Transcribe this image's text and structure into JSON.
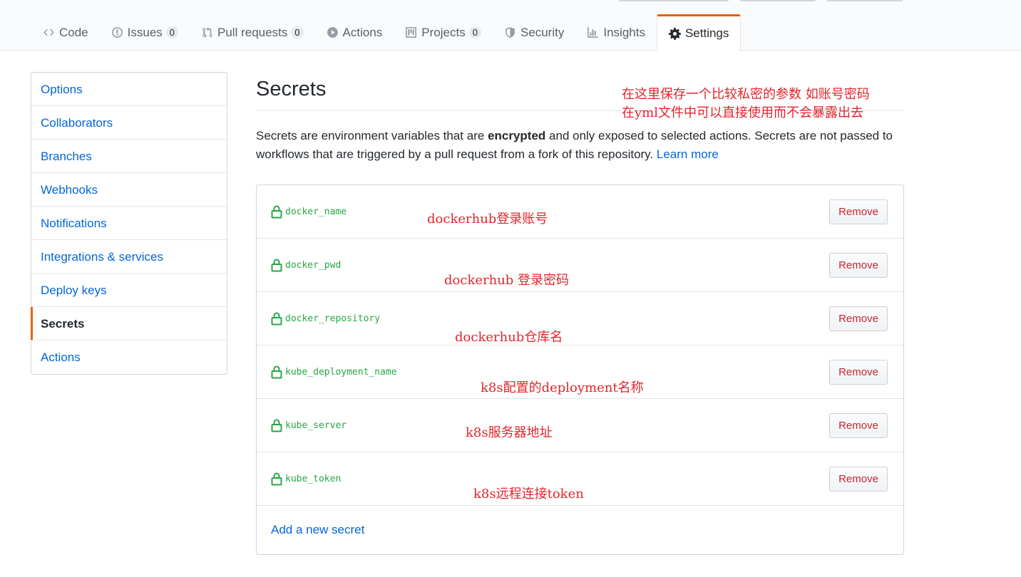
{
  "tabs": [
    {
      "label": "Code",
      "icon": "code-icon",
      "counter": null,
      "selected": false
    },
    {
      "label": "Issues",
      "icon": "issue-icon",
      "counter": "0",
      "selected": false
    },
    {
      "label": "Pull requests",
      "icon": "pull-request-icon",
      "counter": "0",
      "selected": false
    },
    {
      "label": "Actions",
      "icon": "play-icon",
      "counter": null,
      "selected": false
    },
    {
      "label": "Projects",
      "icon": "project-icon",
      "counter": "0",
      "selected": false
    },
    {
      "label": "Security",
      "icon": "shield-icon",
      "counter": null,
      "selected": false
    },
    {
      "label": "Insights",
      "icon": "graph-icon",
      "counter": null,
      "selected": false
    },
    {
      "label": "Settings",
      "icon": "gear-icon",
      "counter": null,
      "selected": true
    }
  ],
  "sidebar": {
    "items": [
      {
        "label": "Options",
        "active": false
      },
      {
        "label": "Collaborators",
        "active": false
      },
      {
        "label": "Branches",
        "active": false
      },
      {
        "label": "Webhooks",
        "active": false
      },
      {
        "label": "Notifications",
        "active": false
      },
      {
        "label": "Integrations & services",
        "active": false
      },
      {
        "label": "Deploy keys",
        "active": false
      },
      {
        "label": "Secrets",
        "active": true
      },
      {
        "label": "Actions",
        "active": false
      }
    ]
  },
  "main": {
    "title": "Secrets",
    "desc_before": "Secrets are environment variables that are ",
    "desc_bold": "encrypted",
    "desc_after": " and only exposed to selected actions. Secrets are not passed to workflows that are triggered by a pull request from a fork of this repository. ",
    "learn_more": "Learn more",
    "secrets": [
      {
        "name": "docker_name",
        "remove_label": "Remove"
      },
      {
        "name": "docker_pwd",
        "remove_label": "Remove"
      },
      {
        "name": "docker_repository",
        "remove_label": "Remove"
      },
      {
        "name": "kube_deployment_name",
        "remove_label": "Remove"
      },
      {
        "name": "kube_server",
        "remove_label": "Remove"
      },
      {
        "name": "kube_token",
        "remove_label": "Remove"
      }
    ],
    "add_secret": "Add a new secret"
  },
  "annotations": {
    "header_line1": "在这里保存一个比较私密的参数 如账号密码",
    "header_line2": "在yml文件中可以直接使用而不会暴露出去",
    "docker_name": "dockerhub登录账号",
    "docker_pwd": "dockerhub 登录密码",
    "docker_repository": "dockerhub仓库名",
    "kube_deployment_name": "k8s配置的deployment名称",
    "kube_server": "k8s服务器地址",
    "kube_token": "k8s远程连接token"
  },
  "colors": {
    "accent": "#e36209",
    "link": "#0366d6",
    "secret_green": "#28a745",
    "danger": "#cb2431",
    "annotation_red": "#e3242b"
  }
}
